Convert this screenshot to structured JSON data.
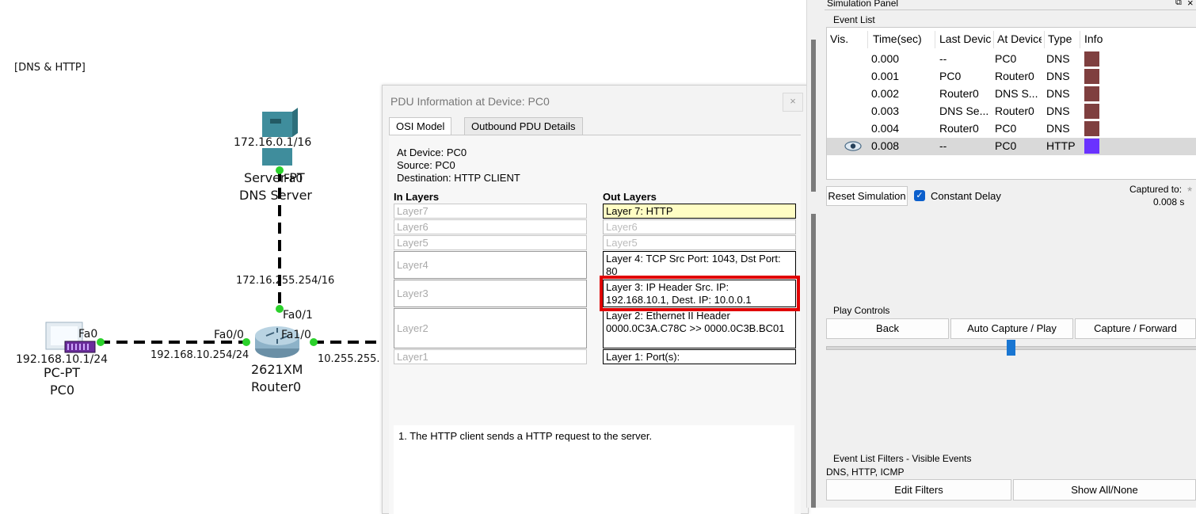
{
  "topology": {
    "scenario_label": "[DNS & HTTP]",
    "server": {
      "ip": "172.16.0.1/16",
      "name_line1": "Server-PT",
      "name_line2": "DNS Server",
      "port": "Fa0"
    },
    "router": {
      "model": "2621XM",
      "name": "Router0",
      "port_fa00": "Fa0/0",
      "port_fa01": "Fa0/1",
      "port_fa10": "Fa1/0",
      "ip_fa00": "192.168.10.254/24",
      "ip_fa01": "172.16.255.254/16",
      "ip_fa10": "10.255.255."
    },
    "pc": {
      "model": "PC-PT",
      "name": "PC0",
      "ip": "192.168.10.1/24",
      "port": "Fa0"
    }
  },
  "pdu_dialog": {
    "title": "PDU Information at Device: PC0",
    "close": "×",
    "tabs": [
      "OSI Model",
      "Outbound PDU Details"
    ],
    "at_device": "At Device: PC0",
    "source": "Source: PC0",
    "destination": "Destination: HTTP CLIENT",
    "in_layers_header": "In Layers",
    "out_layers_header": "Out Layers",
    "in_layers": [
      "Layer7",
      "Layer6",
      "Layer5",
      "Layer4",
      "Layer3",
      "Layer2",
      "Layer1"
    ],
    "out_layers": [
      "Layer 7: HTTP",
      "Layer6",
      "Layer5",
      "Layer 4: TCP Src Port: 1043, Dst Port: 80",
      "Layer 3: IP Header Src. IP: 192.168.10.1, Dest. IP: 10.0.0.1",
      "Layer 2: Ethernet II Header 0000.0C3A.C78C >> 0000.0C3B.BC01",
      "Layer 1: Port(s):"
    ],
    "description": "1. The HTTP client sends a HTTP request to the server."
  },
  "simulation_panel": {
    "title": "Simulation Panel",
    "event_list_label": "Event List",
    "columns": [
      "Vis.",
      "Time(sec)",
      "Last Device",
      "At Device",
      "Type",
      "Info"
    ],
    "events": [
      {
        "time": "0.000",
        "last": "--",
        "at": "PC0",
        "type": "DNS",
        "color": "#7f3f3f"
      },
      {
        "time": "0.001",
        "last": "PC0",
        "at": "Router0",
        "type": "DNS",
        "color": "#7f3f3f"
      },
      {
        "time": "0.002",
        "last": "Router0",
        "at": "DNS S...",
        "type": "DNS",
        "color": "#7f3f3f"
      },
      {
        "time": "0.003",
        "last": "DNS Se...",
        "at": "Router0",
        "type": "DNS",
        "color": "#7f3f3f"
      },
      {
        "time": "0.004",
        "last": "Router0",
        "at": "PC0",
        "type": "DNS",
        "color": "#7f3f3f"
      },
      {
        "time": "0.008",
        "last": "--",
        "at": "PC0",
        "type": "HTTP",
        "color": "#6a32ff"
      }
    ],
    "reset_button": "Reset Simulation",
    "constant_delay_label": "Constant Delay",
    "captured_to_label": "Captured to:",
    "captured_to_value": "0.008 s",
    "play_controls_label": "Play Controls",
    "back_button": "Back",
    "auto_capture_button": "Auto Capture / Play",
    "capture_forward_button": "Capture / Forward",
    "filters_label": "Event List Filters - Visible Events",
    "filters_value": "DNS, HTTP, ICMP",
    "edit_filters_button": "Edit Filters",
    "show_all_button": "Show All/None"
  }
}
